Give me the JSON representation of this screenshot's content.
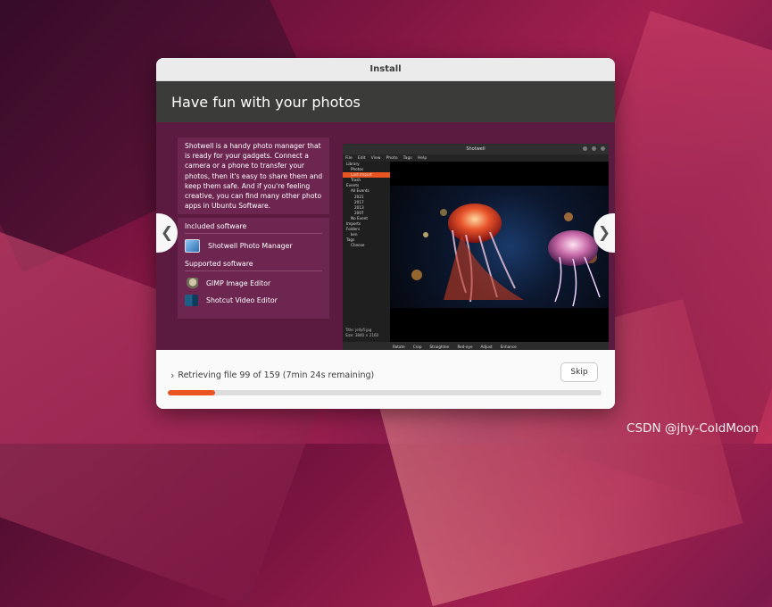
{
  "window": {
    "title": "Install"
  },
  "slide": {
    "heading": "Have fun with your photos",
    "description": "Shotwell is a handy photo manager that is ready for your gadgets. Connect a camera or a phone to transfer your photos, then it's easy to share them and keep them safe. And if you're feeling creative, you can find many other photo apps in Ubuntu Software.",
    "included_heading": "Included software",
    "included": [
      {
        "label": "Shotwell Photo Manager",
        "icon": "shotwell-icon"
      }
    ],
    "supported_heading": "Supported software",
    "supported": [
      {
        "label": "GIMP Image Editor",
        "icon": "gimp-icon"
      },
      {
        "label": "Shotcut Video Editor",
        "icon": "shotcut-icon"
      }
    ],
    "prev_glyph": "❮",
    "next_glyph": "❯"
  },
  "screenshot": {
    "app_title": "Shotwell",
    "menu": [
      "File",
      "Edit",
      "View",
      "Photo",
      "Tags",
      "Help"
    ],
    "sidebar": [
      "Library",
      "Photos",
      "Last Import",
      "Trash",
      "Events",
      "All Events",
      "2021",
      "2017",
      "2013",
      "2007",
      "No Event",
      "Imports",
      "Folders",
      "ken",
      "Tags",
      "Cheese"
    ],
    "meta_title": "Title: jellyfi.jpg",
    "meta_size": "Size: 3840 × 2160",
    "toolbar": [
      "Rotate",
      "Crop",
      "Straighten",
      "Red-eye",
      "Adjust",
      "Enhance"
    ]
  },
  "footer": {
    "chevron": "›",
    "status": "Retrieving file 99 of 159 (7min 24s remaining)",
    "skip_label": "Skip",
    "progress_fraction": 0.109,
    "accent": "#e95420"
  },
  "watermark": "CSDN @jhy-ColdMoon"
}
